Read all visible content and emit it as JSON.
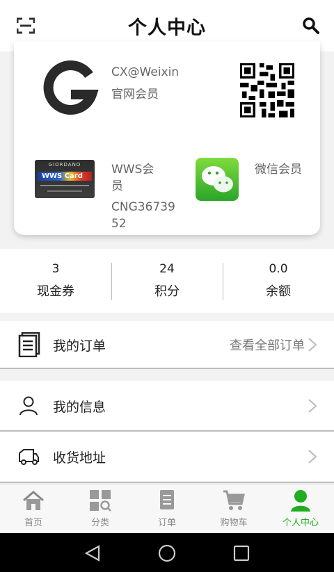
{
  "header": {
    "title": "个人中心",
    "left_icon": "scan-icon",
    "right_icon": "search-icon"
  },
  "membership": {
    "official": {
      "line1": "CX@Weixin",
      "line2": "官网会员"
    },
    "wws": {
      "line1": "WWS会",
      "line2": "员",
      "line3": "CNG36739",
      "line4": "52",
      "card_brand": "GIORDANO",
      "card_text": "WWS Card"
    },
    "wechat": {
      "label": "微信会员"
    }
  },
  "stats": [
    {
      "value": "3",
      "label": "现金券"
    },
    {
      "value": "24",
      "label": "积分"
    },
    {
      "value": "0.0",
      "label": "余额"
    }
  ],
  "menu": {
    "orders": {
      "label": "我的订单",
      "link": "查看全部订单"
    },
    "info": {
      "label": "我的信息"
    },
    "address": {
      "label": "收货地址"
    }
  },
  "tabs": [
    {
      "label": "首页",
      "icon": "home-icon"
    },
    {
      "label": "分类",
      "icon": "category-icon"
    },
    {
      "label": "订单",
      "icon": "orders-icon"
    },
    {
      "label": "购物车",
      "icon": "cart-icon"
    },
    {
      "label": "个人中心",
      "icon": "profile-icon",
      "active": true
    }
  ],
  "colors": {
    "accent": "#1fae1f",
    "text": "#222222",
    "muted": "#777777"
  }
}
